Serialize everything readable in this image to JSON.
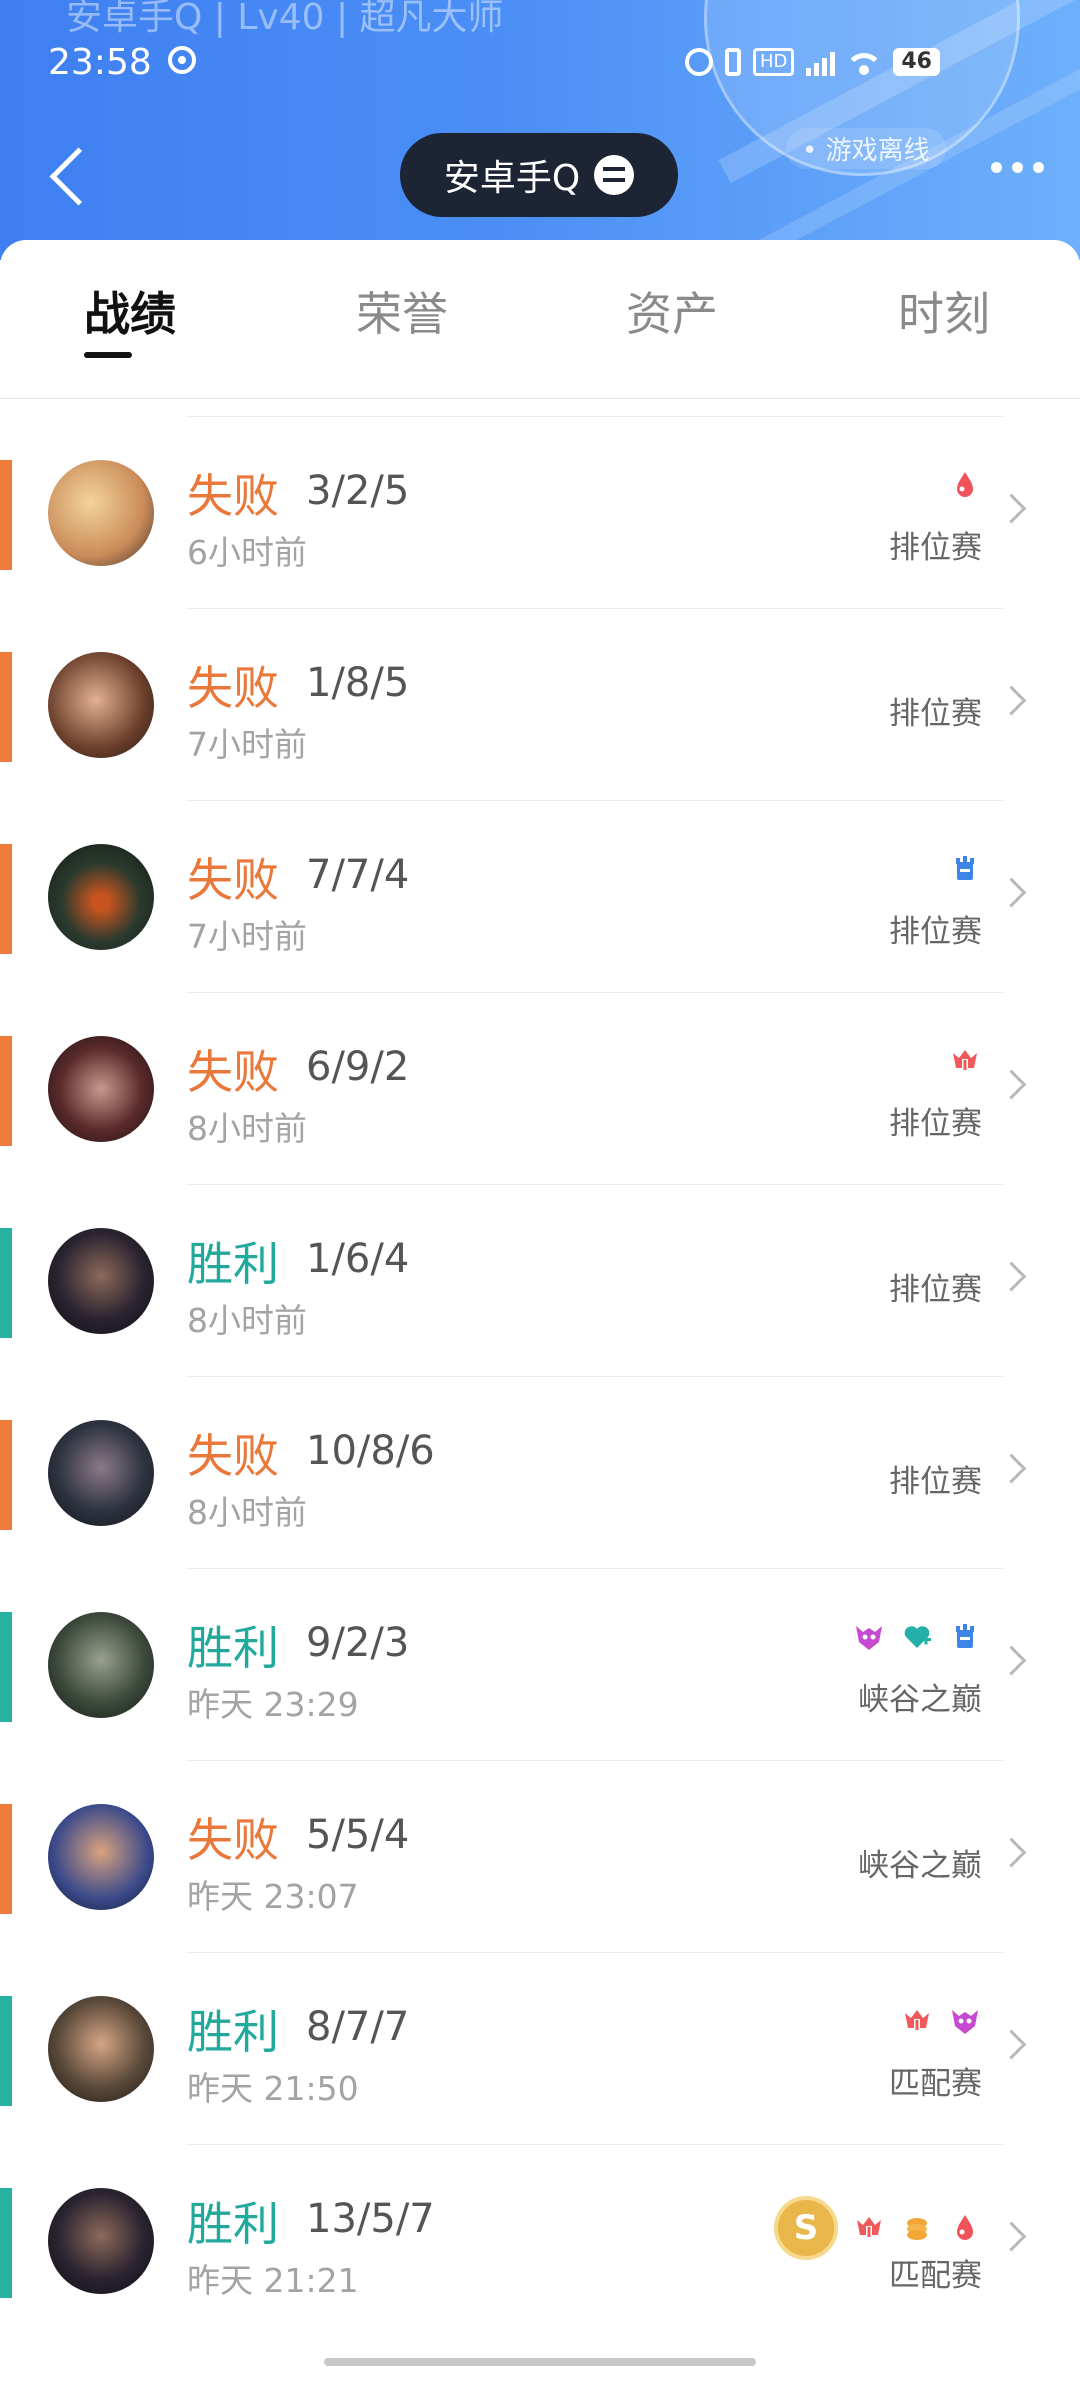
{
  "header": {
    "watermark": "安卓手Q | Lv40 | 超凡大师",
    "time": "23:58",
    "battery": "46",
    "offline_status": "• 游戏离线",
    "account_label": "安卓手Q"
  },
  "tabs": [
    {
      "label": "战绩",
      "active": true
    },
    {
      "label": "荣誉",
      "active": false
    },
    {
      "label": "资产",
      "active": false
    },
    {
      "label": "时刻",
      "active": false
    }
  ],
  "colors": {
    "lose": "#ee7b38",
    "win": "#28b2a1",
    "accent": "#3f7ff1"
  },
  "matches": [
    {
      "result": "失败",
      "outcome": "lose",
      "kda": "3/2/5",
      "time": "6小时前",
      "mode": "排位赛",
      "badges": [
        "drop-red-icon"
      ],
      "avatar": "champion-blonde-female"
    },
    {
      "result": "失败",
      "outcome": "lose",
      "kda": "1/8/5",
      "time": "7小时前",
      "mode": "排位赛",
      "badges": [],
      "avatar": "champion-brown-hair-female"
    },
    {
      "result": "失败",
      "outcome": "lose",
      "kda": "7/7/4",
      "time": "7小时前",
      "mode": "排位赛",
      "badges": [
        "tower-blue-icon"
      ],
      "avatar": "champion-dark-helmet"
    },
    {
      "result": "失败",
      "outcome": "lose",
      "kda": "6/9/2",
      "time": "8小时前",
      "mode": "排位赛",
      "badges": [
        "crown-red-icon"
      ],
      "avatar": "champion-bearded-warrior"
    },
    {
      "result": "胜利",
      "outcome": "win",
      "kda": "1/6/4",
      "time": "8小时前",
      "mode": "排位赛",
      "badges": [],
      "avatar": "champion-dark-warrior"
    },
    {
      "result": "失败",
      "outcome": "lose",
      "kda": "10/8/6",
      "time": "8小时前",
      "mode": "排位赛",
      "badges": [],
      "avatar": "champion-masked-warrior"
    },
    {
      "result": "胜利",
      "outcome": "win",
      "kda": "9/2/3",
      "time": "昨天 23:29",
      "mode": "峡谷之巅",
      "badges": [
        "demon-pink-icon",
        "heart-teal-icon",
        "tower-blue-icon"
      ],
      "avatar": "champion-beast"
    },
    {
      "result": "失败",
      "outcome": "lose",
      "kda": "5/5/4",
      "time": "昨天 23:07",
      "mode": "峡谷之巅",
      "badges": [],
      "avatar": "champion-shouting-male"
    },
    {
      "result": "胜利",
      "outcome": "win",
      "kda": "8/7/7",
      "time": "昨天 21:50",
      "mode": "匹配赛",
      "badges": [
        "crown-red-icon",
        "demon-pink-icon"
      ],
      "avatar": "champion-young-male"
    },
    {
      "result": "胜利",
      "outcome": "win",
      "kda": "13/5/7",
      "time": "昨天 21:21",
      "mode": "匹配赛",
      "badges": [
        "gold-s-coin-icon",
        "crown-red-icon",
        "coins-orange-icon",
        "drop-red-icon"
      ],
      "avatar": "champion-dark-warrior"
    }
  ]
}
